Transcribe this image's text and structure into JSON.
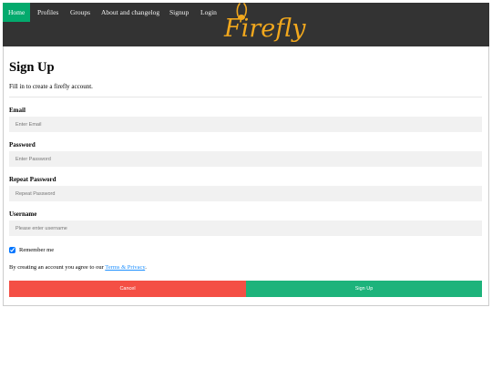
{
  "nav": {
    "items": [
      {
        "label": "Home",
        "active": true
      },
      {
        "label": "Profiles",
        "active": false
      },
      {
        "label": "Groups",
        "active": false
      },
      {
        "label": "About and changelog",
        "active": false
      },
      {
        "label": "Signup",
        "active": false
      },
      {
        "label": "Login",
        "active": false
      }
    ],
    "logo_text": "Firefly"
  },
  "form": {
    "title": "Sign Up",
    "subtitle": "Fill in to create a firefly account.",
    "fields": [
      {
        "label": "Email",
        "placeholder": "Enter Email",
        "value": ""
      },
      {
        "label": "Password",
        "placeholder": "Enter Password",
        "value": ""
      },
      {
        "label": "Repeat Password",
        "placeholder": "Repeat Password",
        "value": ""
      },
      {
        "label": "Username",
        "placeholder": "Please enter username",
        "value": ""
      }
    ],
    "remember_label": "Remember me",
    "remember_checked": true,
    "terms_prefix": "By creating an account you agree to our",
    "terms_link": "Terms & Privacy",
    "terms_suffix": ".",
    "cancel_label": "Cancel",
    "signup_label": "Sign Up"
  },
  "colors": {
    "navbar": "#333333",
    "nav_active": "#04AA6D",
    "logo": "#f2a81d",
    "cancel": "#f44f45",
    "signup": "#1db37b",
    "link": "#1e90ff"
  }
}
